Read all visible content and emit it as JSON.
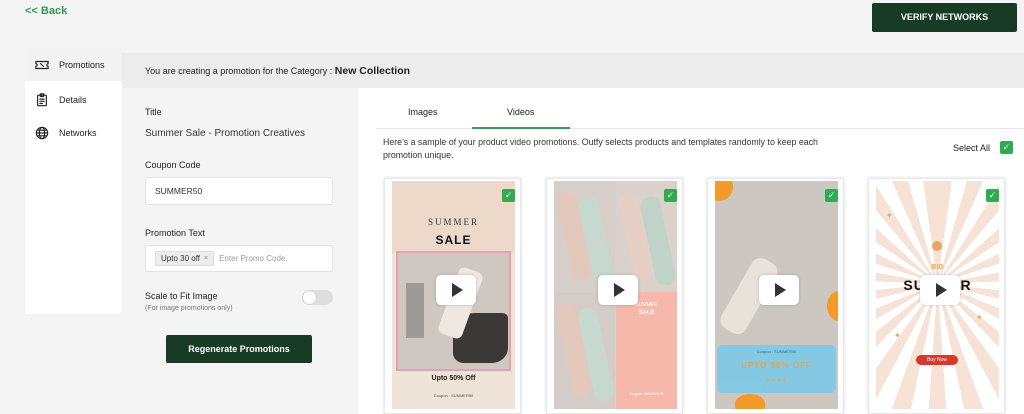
{
  "header": {
    "back_label": "<< Back",
    "verify_label": "VERIFY NETWORKS",
    "category_prefix": "You are creating a promotion for the Category :",
    "category_name": "New Collection"
  },
  "sidebar": {
    "items": [
      {
        "label": "Promotions",
        "icon": "ticket-icon"
      },
      {
        "label": "Details",
        "icon": "clipboard-icon"
      },
      {
        "label": "Networks",
        "icon": "globe-icon"
      }
    ]
  },
  "form": {
    "title_label": "Title",
    "title_value": "Summer Sale - Promotion Creatives",
    "coupon_label": "Coupon Code",
    "coupon_value": "SUMMER50",
    "promo_label": "Promotion Text",
    "promo_chip": "Upto 30 off",
    "promo_chip_remove": "×",
    "promo_placeholder": "Enter Promo Code.",
    "scale_label": "Scale to Fit Image",
    "scale_note": "(For image promotions only)",
    "scale_enabled": false,
    "regenerate_label": "Regenerate Promotions"
  },
  "panel": {
    "tabs": [
      {
        "label": "Images",
        "active": false
      },
      {
        "label": "Videos",
        "active": true
      }
    ],
    "description": "Here's a sample of your product video promotions. Outfy selects products and templates randomly to keep each promotion unique.",
    "select_all_label": "Select All",
    "select_all_checked": true,
    "checkmark": "✓"
  },
  "cards": [
    {
      "overlay_top": "SUMMER",
      "overlay_big": "SALE",
      "overlay_bottom": "Upto 50% Off",
      "overlay_tiny": "Coupon : SUMMER50",
      "checked": true
    },
    {
      "overlay_top": "SUMMER",
      "overlay_big": "SALE",
      "overlay_bottom": "",
      "overlay_tiny": "Coupon : NEWCOL50",
      "checked": true
    },
    {
      "overlay_top": "Coupon : SUMMER50",
      "overlay_big": "UPTO 50% OFF",
      "overlay_bottom": "",
      "overlay_tiny": "",
      "checked": true
    },
    {
      "overlay_top": "BIG",
      "overlay_big": "SUMMER",
      "overlay_bottom": "Buy Now",
      "overlay_tiny": "",
      "checked": true
    }
  ],
  "colors": {
    "brand_dark_green": "#173b24",
    "accent_green": "#2fab52",
    "back_link_green": "#2f9a4c"
  }
}
